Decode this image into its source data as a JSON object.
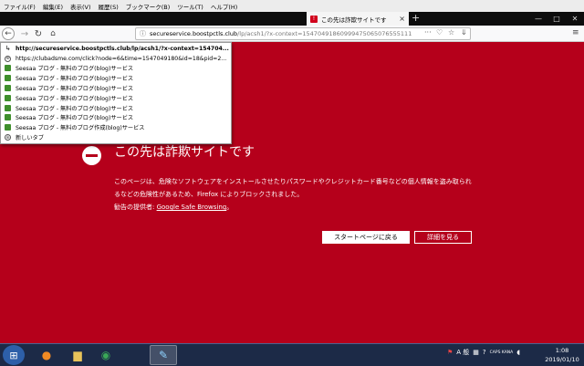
{
  "menubar": {
    "items": [
      "ファイル(F)",
      "編集(E)",
      "表示(V)",
      "履歴(S)",
      "ブックマーク(B)",
      "ツール(T)",
      "ヘルプ(H)"
    ]
  },
  "tab": {
    "title": "この先は詐欺サイトです",
    "new_tab": "+"
  },
  "urlbar": {
    "host": "secureservice.boostpctls.club",
    "path": "/lp/acsh1/?x-context=15470491860999475065076555111"
  },
  "dropdown": {
    "items": [
      {
        "icon": "arrow-icon",
        "text": "http://secureservice.boostpctls.club/lp/acsh1/?x-context=154704...",
        "bold": true
      },
      {
        "icon": "globe-icon",
        "text": "https://clubadsme.com/click?node=6&time=1547049180&id=18&pid=2...",
        "bold": false
      },
      {
        "icon": "seesaa-icon",
        "text": "Seesaa ブログ - 無料のブログ(blog)サービス",
        "bold": false
      },
      {
        "icon": "seesaa-icon",
        "text": "Seesaa ブログ - 無料のブログ(blog)サービス",
        "bold": false
      },
      {
        "icon": "seesaa-icon",
        "text": "Seesaa ブログ - 無料のブログ(blog)サービス",
        "bold": false
      },
      {
        "icon": "seesaa-icon",
        "text": "Seesaa ブログ - 無料のブログ(blog)サービス",
        "bold": false
      },
      {
        "icon": "seesaa-icon",
        "text": "Seesaa ブログ - 無料のブログ(blog)サービス",
        "bold": false
      },
      {
        "icon": "seesaa-icon",
        "text": "Seesaa ブログ - 無料のブログ(blog)サービス",
        "bold": false
      },
      {
        "icon": "seesaa-icon",
        "text": "Seesaa ブログ - 無料のブログ作成(blog)サービス",
        "bold": false
      },
      {
        "icon": "globe-icon",
        "text": "新しいタブ",
        "bold": false
      }
    ]
  },
  "warning": {
    "title": "この先は詐欺サイトです",
    "description": "このページは、危険なソフトウェアをインストールさせたりパスワードやクレジットカード番号などの個人情報を盗み取られるなどの危険性があるため、Firefox によりブロックされました。",
    "advisory_prefix": "勧告の提供者: ",
    "advisory_link": "Google Safe Browsing",
    "advisory_suffix": "。",
    "home_button": "スタートページに戻る",
    "details_button": "詳細を見る"
  },
  "taskbar": {
    "tray_lang": "A 般",
    "tray_caps": "CAPS KANA",
    "time": "1:08",
    "date": "2019/01/10"
  },
  "colors": {
    "warning_bg": "#b5001b",
    "tab_strip": "#0d0d0d",
    "taskbar": "#1c2a47"
  }
}
